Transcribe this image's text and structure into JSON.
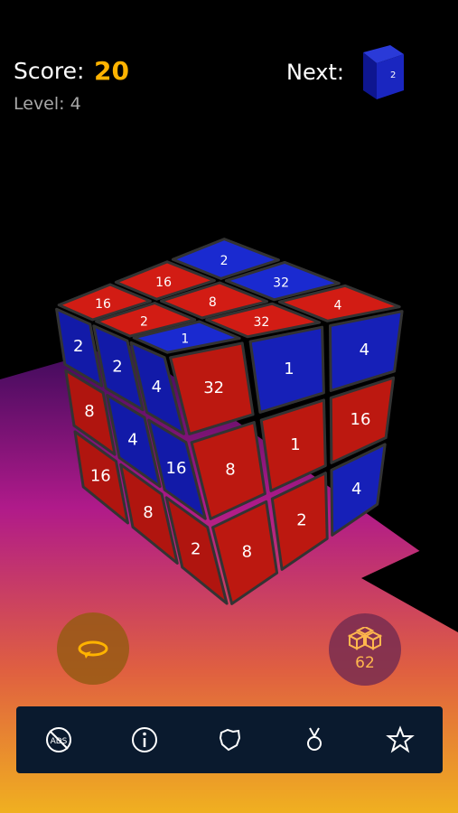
{
  "hud": {
    "score_label": "Score:",
    "score_value": "20",
    "level_text": "Level: 4",
    "next_label": "Next:",
    "next_value": "2"
  },
  "cube": {
    "top": [
      "16",
      "16",
      "2",
      "2",
      "8",
      "32",
      "1",
      "32",
      "4"
    ],
    "left": [
      "2",
      "2",
      "4",
      "8",
      "4",
      "16",
      "16",
      "8",
      "2"
    ],
    "right": [
      "32",
      "1",
      "4",
      "8",
      "1",
      "16",
      "8",
      "2",
      "4"
    ]
  },
  "controls": {
    "rotate_icon": "rotate-icon",
    "boost_icon": "cubes-icon",
    "boost_count": "62"
  },
  "bottom_bar": {
    "items": [
      "no-ads-icon",
      "info-icon",
      "achievement-icon",
      "medal-icon",
      "star-icon"
    ]
  },
  "colors": {
    "red": "#c91a14",
    "blue": "#1622b8",
    "accent": "#ffb300",
    "bar_bg": "#0a1a2e"
  }
}
